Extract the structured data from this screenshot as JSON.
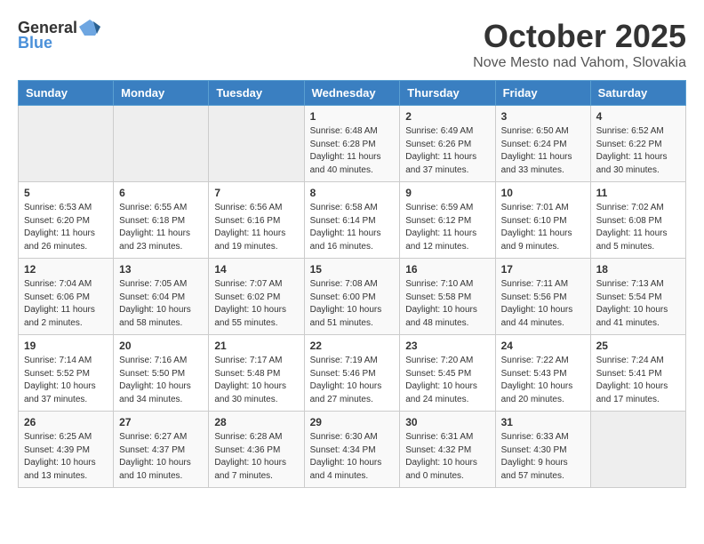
{
  "logo": {
    "general": "General",
    "blue": "Blue"
  },
  "header": {
    "month": "October 2025",
    "location": "Nove Mesto nad Vahom, Slovakia"
  },
  "weekdays": [
    "Sunday",
    "Monday",
    "Tuesday",
    "Wednesday",
    "Thursday",
    "Friday",
    "Saturday"
  ],
  "rows": [
    [
      {
        "day": "",
        "empty": true
      },
      {
        "day": "",
        "empty": true
      },
      {
        "day": "",
        "empty": true
      },
      {
        "day": "1",
        "sunrise": "6:48 AM",
        "sunset": "6:28 PM",
        "daylight": "11 hours and 40 minutes."
      },
      {
        "day": "2",
        "sunrise": "6:49 AM",
        "sunset": "6:26 PM",
        "daylight": "11 hours and 37 minutes."
      },
      {
        "day": "3",
        "sunrise": "6:50 AM",
        "sunset": "6:24 PM",
        "daylight": "11 hours and 33 minutes."
      },
      {
        "day": "4",
        "sunrise": "6:52 AM",
        "sunset": "6:22 PM",
        "daylight": "11 hours and 30 minutes."
      }
    ],
    [
      {
        "day": "5",
        "sunrise": "6:53 AM",
        "sunset": "6:20 PM",
        "daylight": "11 hours and 26 minutes."
      },
      {
        "day": "6",
        "sunrise": "6:55 AM",
        "sunset": "6:18 PM",
        "daylight": "11 hours and 23 minutes."
      },
      {
        "day": "7",
        "sunrise": "6:56 AM",
        "sunset": "6:16 PM",
        "daylight": "11 hours and 19 minutes."
      },
      {
        "day": "8",
        "sunrise": "6:58 AM",
        "sunset": "6:14 PM",
        "daylight": "11 hours and 16 minutes."
      },
      {
        "day": "9",
        "sunrise": "6:59 AM",
        "sunset": "6:12 PM",
        "daylight": "11 hours and 12 minutes."
      },
      {
        "day": "10",
        "sunrise": "7:01 AM",
        "sunset": "6:10 PM",
        "daylight": "11 hours and 9 minutes."
      },
      {
        "day": "11",
        "sunrise": "7:02 AM",
        "sunset": "6:08 PM",
        "daylight": "11 hours and 5 minutes."
      }
    ],
    [
      {
        "day": "12",
        "sunrise": "7:04 AM",
        "sunset": "6:06 PM",
        "daylight": "11 hours and 2 minutes."
      },
      {
        "day": "13",
        "sunrise": "7:05 AM",
        "sunset": "6:04 PM",
        "daylight": "10 hours and 58 minutes."
      },
      {
        "day": "14",
        "sunrise": "7:07 AM",
        "sunset": "6:02 PM",
        "daylight": "10 hours and 55 minutes."
      },
      {
        "day": "15",
        "sunrise": "7:08 AM",
        "sunset": "6:00 PM",
        "daylight": "10 hours and 51 minutes."
      },
      {
        "day": "16",
        "sunrise": "7:10 AM",
        "sunset": "5:58 PM",
        "daylight": "10 hours and 48 minutes."
      },
      {
        "day": "17",
        "sunrise": "7:11 AM",
        "sunset": "5:56 PM",
        "daylight": "10 hours and 44 minutes."
      },
      {
        "day": "18",
        "sunrise": "7:13 AM",
        "sunset": "5:54 PM",
        "daylight": "10 hours and 41 minutes."
      }
    ],
    [
      {
        "day": "19",
        "sunrise": "7:14 AM",
        "sunset": "5:52 PM",
        "daylight": "10 hours and 37 minutes."
      },
      {
        "day": "20",
        "sunrise": "7:16 AM",
        "sunset": "5:50 PM",
        "daylight": "10 hours and 34 minutes."
      },
      {
        "day": "21",
        "sunrise": "7:17 AM",
        "sunset": "5:48 PM",
        "daylight": "10 hours and 30 minutes."
      },
      {
        "day": "22",
        "sunrise": "7:19 AM",
        "sunset": "5:46 PM",
        "daylight": "10 hours and 27 minutes."
      },
      {
        "day": "23",
        "sunrise": "7:20 AM",
        "sunset": "5:45 PM",
        "daylight": "10 hours and 24 minutes."
      },
      {
        "day": "24",
        "sunrise": "7:22 AM",
        "sunset": "5:43 PM",
        "daylight": "10 hours and 20 minutes."
      },
      {
        "day": "25",
        "sunrise": "7:24 AM",
        "sunset": "5:41 PM",
        "daylight": "10 hours and 17 minutes."
      }
    ],
    [
      {
        "day": "26",
        "sunrise": "6:25 AM",
        "sunset": "4:39 PM",
        "daylight": "10 hours and 13 minutes."
      },
      {
        "day": "27",
        "sunrise": "6:27 AM",
        "sunset": "4:37 PM",
        "daylight": "10 hours and 10 minutes."
      },
      {
        "day": "28",
        "sunrise": "6:28 AM",
        "sunset": "4:36 PM",
        "daylight": "10 hours and 7 minutes."
      },
      {
        "day": "29",
        "sunrise": "6:30 AM",
        "sunset": "4:34 PM",
        "daylight": "10 hours and 4 minutes."
      },
      {
        "day": "30",
        "sunrise": "6:31 AM",
        "sunset": "4:32 PM",
        "daylight": "10 hours and 0 minutes."
      },
      {
        "day": "31",
        "sunrise": "6:33 AM",
        "sunset": "4:30 PM",
        "daylight": "9 hours and 57 minutes."
      },
      {
        "day": "",
        "empty": true
      }
    ]
  ]
}
